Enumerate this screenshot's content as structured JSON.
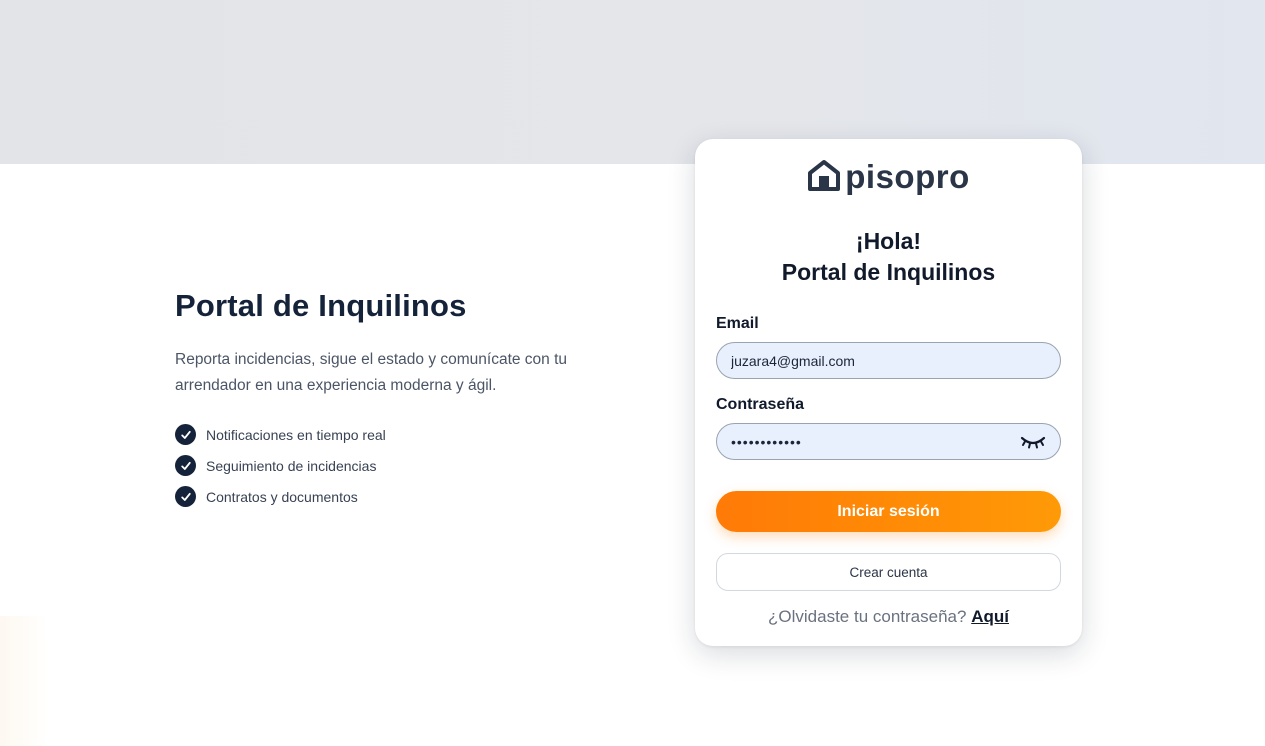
{
  "hero": {
    "title": "Portal de Inquilinos",
    "description": "Reporta incidencias, sigue el estado y comunícate con tu arrendador en una experiencia moderna y ágil.",
    "features": [
      "Notificaciones en tiempo real",
      "Seguimiento de incidencias",
      "Contratos y documentos"
    ]
  },
  "card": {
    "logo_text": "pisopro",
    "greeting": "¡Hola!",
    "subtitle": "Portal de Inquilinos",
    "email_label": "Email",
    "email_value": "juzara4@gmail.com",
    "password_label": "Contraseña",
    "password_value": "••••••••••••",
    "login_button": "Iniciar sesión",
    "register_button": "Crear cuenta",
    "forgot_text": "¿Olvidaste tu contraseña?",
    "forgot_link": "Aquí"
  },
  "icons": {
    "check": "check-icon",
    "logo": "house-icon",
    "toggle_password": "eye-closed-icon"
  },
  "colors": {
    "primary_dark": "#15233a",
    "accent_orange": "#ff8a06",
    "input_bg": "#e8f0fe"
  }
}
